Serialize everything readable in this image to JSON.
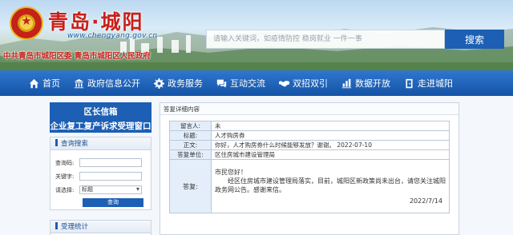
{
  "header": {
    "site_title": "青岛·城阳",
    "site_url": "www.chengyang.gov.cn",
    "slogan": "中共青岛市城阳区委  青岛市城阳区人民政府",
    "search_placeholder": "请输入关键词，如疫情防控 稳岗就业 一件一事",
    "search_button": "搜索"
  },
  "nav": {
    "items": [
      {
        "label": "首页",
        "icon": "home-icon"
      },
      {
        "label": "政府信息公开",
        "icon": "building-icon"
      },
      {
        "label": "政务服务",
        "icon": "gear-icon"
      },
      {
        "label": "互动交流",
        "icon": "chat-icon"
      },
      {
        "label": "双招双引",
        "icon": "handshake-icon"
      },
      {
        "label": "数据开放",
        "icon": "chart-icon"
      },
      {
        "label": "走进城阳",
        "icon": "door-icon"
      }
    ]
  },
  "sidebar": {
    "head_line1": "区长信箱",
    "head_line2": "企业复工复产诉求受理窗口",
    "query": {
      "title": "查询搜索",
      "label_code": "查询码:",
      "label_keyword": "关键字:",
      "label_choice": "请选择:",
      "choice_value": "标题",
      "button": "查询"
    },
    "stats": {
      "title": "受理统计"
    }
  },
  "detail": {
    "title": "答复详细内容",
    "rows": {
      "sender_label": "留言人:",
      "sender_value": "未",
      "subject_label": "标题:",
      "subject_value": "人才购房券",
      "body_label": "正文:",
      "body_value": "你好，人才购房券什么时候能够发放？谢谢。  2022-07-10",
      "unit_label": "答复单位:",
      "unit_value": "区住房城市建设管理局",
      "reply_label": "答复:",
      "reply_greeting": "市民您好！",
      "reply_body": "经区住房城市建设管理局落实，目前，城阳区新政策尚未出台，请您关注城阳政务网公告。感谢来信。",
      "reply_date": "2022/7/14"
    }
  }
}
